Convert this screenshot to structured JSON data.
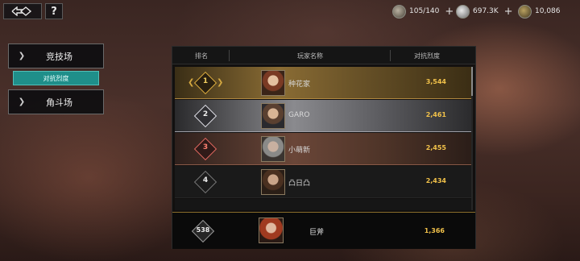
{
  "topbar": {
    "help_label": "?",
    "resources": [
      {
        "icon": "stamina-icon",
        "value": "105/140"
      },
      {
        "icon": "silver-coin-icon",
        "value": "697.3K"
      },
      {
        "icon": "gold-coin-icon",
        "value": "10,086"
      }
    ]
  },
  "menu": {
    "arena_label": "竞技场",
    "arena_subtab": "对抗烈度",
    "brawl_label": "角斗场"
  },
  "leaderboard": {
    "columns": [
      "排名",
      "玩家名称",
      "对抗烈度"
    ],
    "rows": [
      {
        "rank": "1",
        "name": "种花家",
        "score": "3,544"
      },
      {
        "rank": "2",
        "name": "GARO",
        "score": "2,461"
      },
      {
        "rank": "3",
        "name": "小萌新",
        "score": "2,455"
      },
      {
        "rank": "4",
        "name": "凸日凸",
        "score": "2,434"
      }
    ],
    "self": {
      "rank": "538",
      "name": "巨斧",
      "score": "1,366"
    }
  },
  "colors": {
    "accent_teal": "#1f8f8a",
    "score_gold": "#f2c24a",
    "gold": "#e0b040",
    "silver": "#e0e0e8",
    "bronze": "#e26a60"
  }
}
